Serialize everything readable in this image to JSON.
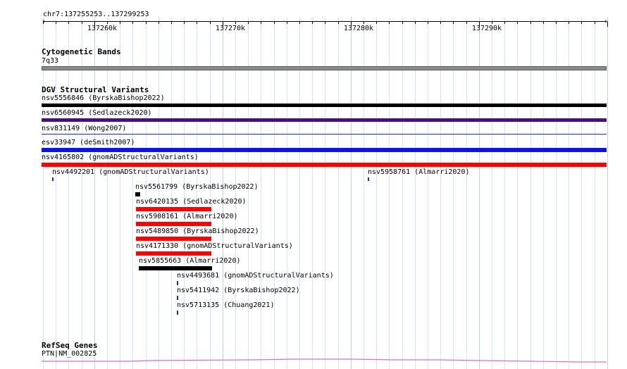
{
  "ruler": {
    "location": "chr7:137255253..137299253",
    "ticks": [
      "137260k",
      "137270k",
      "137280k",
      "137290k"
    ]
  },
  "cytoband": {
    "title": "Cytogenetic Bands",
    "band": "7q33"
  },
  "dgv": {
    "title": "DGV Structural Variants",
    "features": [
      {
        "label": "nsv5556846 (ByrskaBishop2022)",
        "color": "#000000"
      },
      {
        "label": "nsv6560945 (Sedlazeck2020)",
        "color": "#4b0f7a"
      },
      {
        "label": "nsv831149 (Wong2007)",
        "color": "#1a2ccc"
      },
      {
        "label": "esv33947 (deSmith2007)",
        "color": "#0a14e6"
      },
      {
        "label": "nsv4165802 (gnomADStructuralVariants)",
        "color": "#ff0000"
      },
      {
        "label": "nsv4492201 (gnomADStructuralVariants)",
        "color": "#1a2ccc"
      },
      {
        "label": "nsv5958761 (Almarri2020)",
        "color": "#1a2ccc"
      },
      {
        "label": "nsv5561799 (ByrskaBishop2022)",
        "color": "#000000"
      },
      {
        "label": "nsv6420135 (Sedlazeck2020)",
        "color": "#ff0000"
      },
      {
        "label": "nsv5908161 (Almarri2020)",
        "color": "#ff0000"
      },
      {
        "label": "nsv5489850 (ByrskaBishop2022)",
        "color": "#ff0000"
      },
      {
        "label": "nsv4171330 (gnomADStructuralVariants)",
        "color": "#ff0000"
      },
      {
        "label": "nsv5855663 (Almarri2020)",
        "color": "#000000"
      },
      {
        "label": "nsv4493681 (gnomADStructuralVariants)",
        "color": "#1a2ccc"
      },
      {
        "label": "nsv5411942 (ByrskaBishop2022)",
        "color": "#1a2ccc"
      },
      {
        "label": "nsv5713135 (Chuang2021)",
        "color": "#1a2ccc"
      }
    ]
  },
  "refseq": {
    "title": "RefSeq Genes",
    "gene": "PTN|NM_002825",
    "color": "#d070d0"
  }
}
